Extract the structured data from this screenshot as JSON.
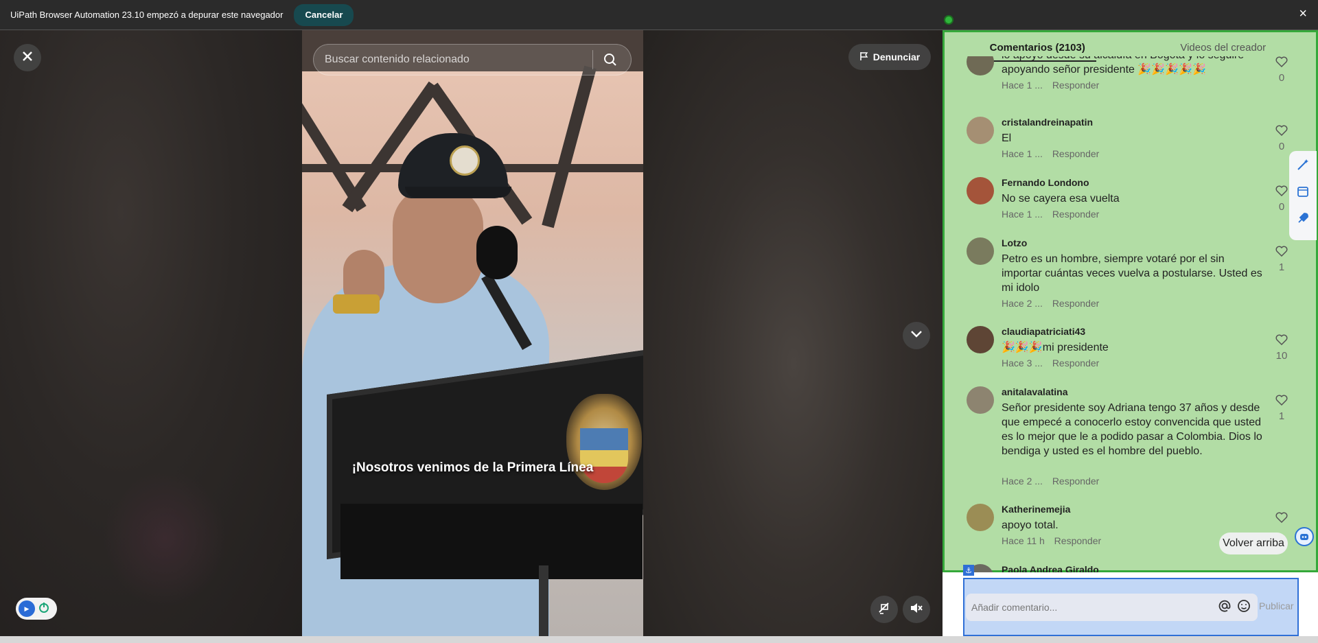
{
  "automation_bar": {
    "message": "UiPath Browser Automation 23.10 empezó a depurar este navegador",
    "cancel_label": "Cancelar",
    "close_icon": "×"
  },
  "viewer": {
    "search_placeholder": "Buscar contenido relacionado",
    "report_label": "Denunciar",
    "subtitle": "¡Nosotros venimos de la Primera Línea"
  },
  "panel": {
    "tabs": [
      {
        "label": "Comentarios (2103)",
        "active": true
      },
      {
        "label": "Videos del creador",
        "active": false
      }
    ],
    "comments": [
      {
        "user": "",
        "text": "lo apoyo desde su alcaldía en Bogotá y lo seguiré apoyando señor presidente 🎉🎉🎉🎉🎉",
        "time": "Hace 1 ...",
        "reply": "Responder",
        "likes": "0"
      },
      {
        "user": "cristalandreinapatin",
        "text": "El",
        "time": "Hace 1 ...",
        "reply": "Responder",
        "likes": "0"
      },
      {
        "user": "Fernando Londono",
        "text": "No se cayera esa vuelta",
        "time": "Hace 1 ...",
        "reply": "Responder",
        "likes": "0"
      },
      {
        "user": "Lotzo",
        "text": "Petro es un hombre, siempre votaré por el sin importar cuántas veces vuelva a postularse. Usted es mi idolo",
        "time": "Hace 2 ...",
        "reply": "Responder",
        "likes": "1"
      },
      {
        "user": "claudiapatriciati43",
        "text": "🎉🎉🎉mi presidente",
        "time": "Hace 3 ...",
        "reply": "Responder",
        "likes": "10"
      },
      {
        "user": "anitalavalatina",
        "text": "Señor presidente soy Adriana tengo 37 años y desde que empecé a conocerlo estoy convencida que usted es lo mejor que le a podido pasar a Colombia. Dios lo bendiga y usted es el hombre del pueblo.",
        "time": "Hace 2 ...",
        "reply": "Responder",
        "likes": "1"
      },
      {
        "user": "Katherinemejia",
        "text": "apoyo total.",
        "time": "Hace 11 h",
        "reply": "Responder",
        "likes": ""
      },
      {
        "user": "Paola Andrea Giraldo",
        "text": "",
        "time": "",
        "reply": "",
        "likes": ""
      }
    ],
    "back_to_top": "Volver arriba",
    "comment_placeholder": "Añadir comentario...",
    "publish_label": "Publicar"
  },
  "colors": {
    "highlight_green": "#35a83a",
    "highlight_blue": "#2f6fd6",
    "cancel_bg": "#17494f"
  }
}
